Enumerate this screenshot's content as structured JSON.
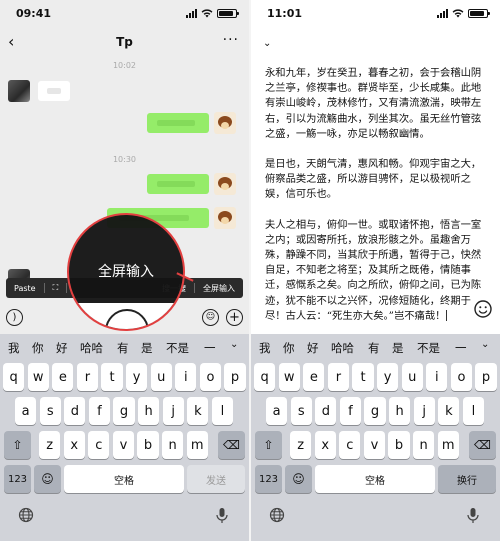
{
  "left": {
    "status_time": "09:41",
    "chat_title": "Tp",
    "timestamps": [
      "10:02",
      "10:30"
    ],
    "context_menu": [
      "Paste",
      "⛶",
      "搜一搜",
      "全屏输入"
    ],
    "magnifier_label": "全屏输入"
  },
  "right": {
    "status_time": "11:01",
    "essay": [
      "永和九年，岁在癸丑，暮春之初，会于会稽山阴之兰亭，修禊事也。群贤毕至，少长咸集。此地有崇山峻岭，茂林修竹，又有清流激湍，映带左右，引以为流觞曲水，列坐其次。虽无丝竹管弦之盛，一觞一咏，亦足以畅叙幽情。",
      "是日也，天朗气清，惠风和畅。仰观宇宙之大，俯察品类之盛，所以游目骋怀，足以极视听之娱，信可乐也。",
      "夫人之相与，俯仰一世。或取诸怀抱，悟言一室之内；或因寄所托，放浪形骸之外。虽趣舍万殊，静躁不同，当其欣于所遇，暂得于己，快然自足，不知老之将至；及其所之既倦，情随事迁，感慨系之矣。向之所欣，俯仰之间，已为陈迹，犹不能不以之兴怀，况修短随化，终期于尽！古人云：“死生亦大矣。”岂不痛哉！"
    ]
  },
  "keyboard": {
    "candidates": [
      "我",
      "你",
      "好",
      "哈哈",
      "有",
      "是",
      "不是",
      "一"
    ],
    "row1": [
      "q",
      "w",
      "e",
      "r",
      "t",
      "y",
      "u",
      "i",
      "o",
      "p"
    ],
    "row2": [
      "a",
      "s",
      "d",
      "f",
      "g",
      "h",
      "j",
      "k",
      "l"
    ],
    "row3": [
      "z",
      "x",
      "c",
      "v",
      "b",
      "n",
      "m"
    ],
    "num_key": "123",
    "space_label": "空格",
    "send_label": "发送",
    "return_label": "换行"
  }
}
